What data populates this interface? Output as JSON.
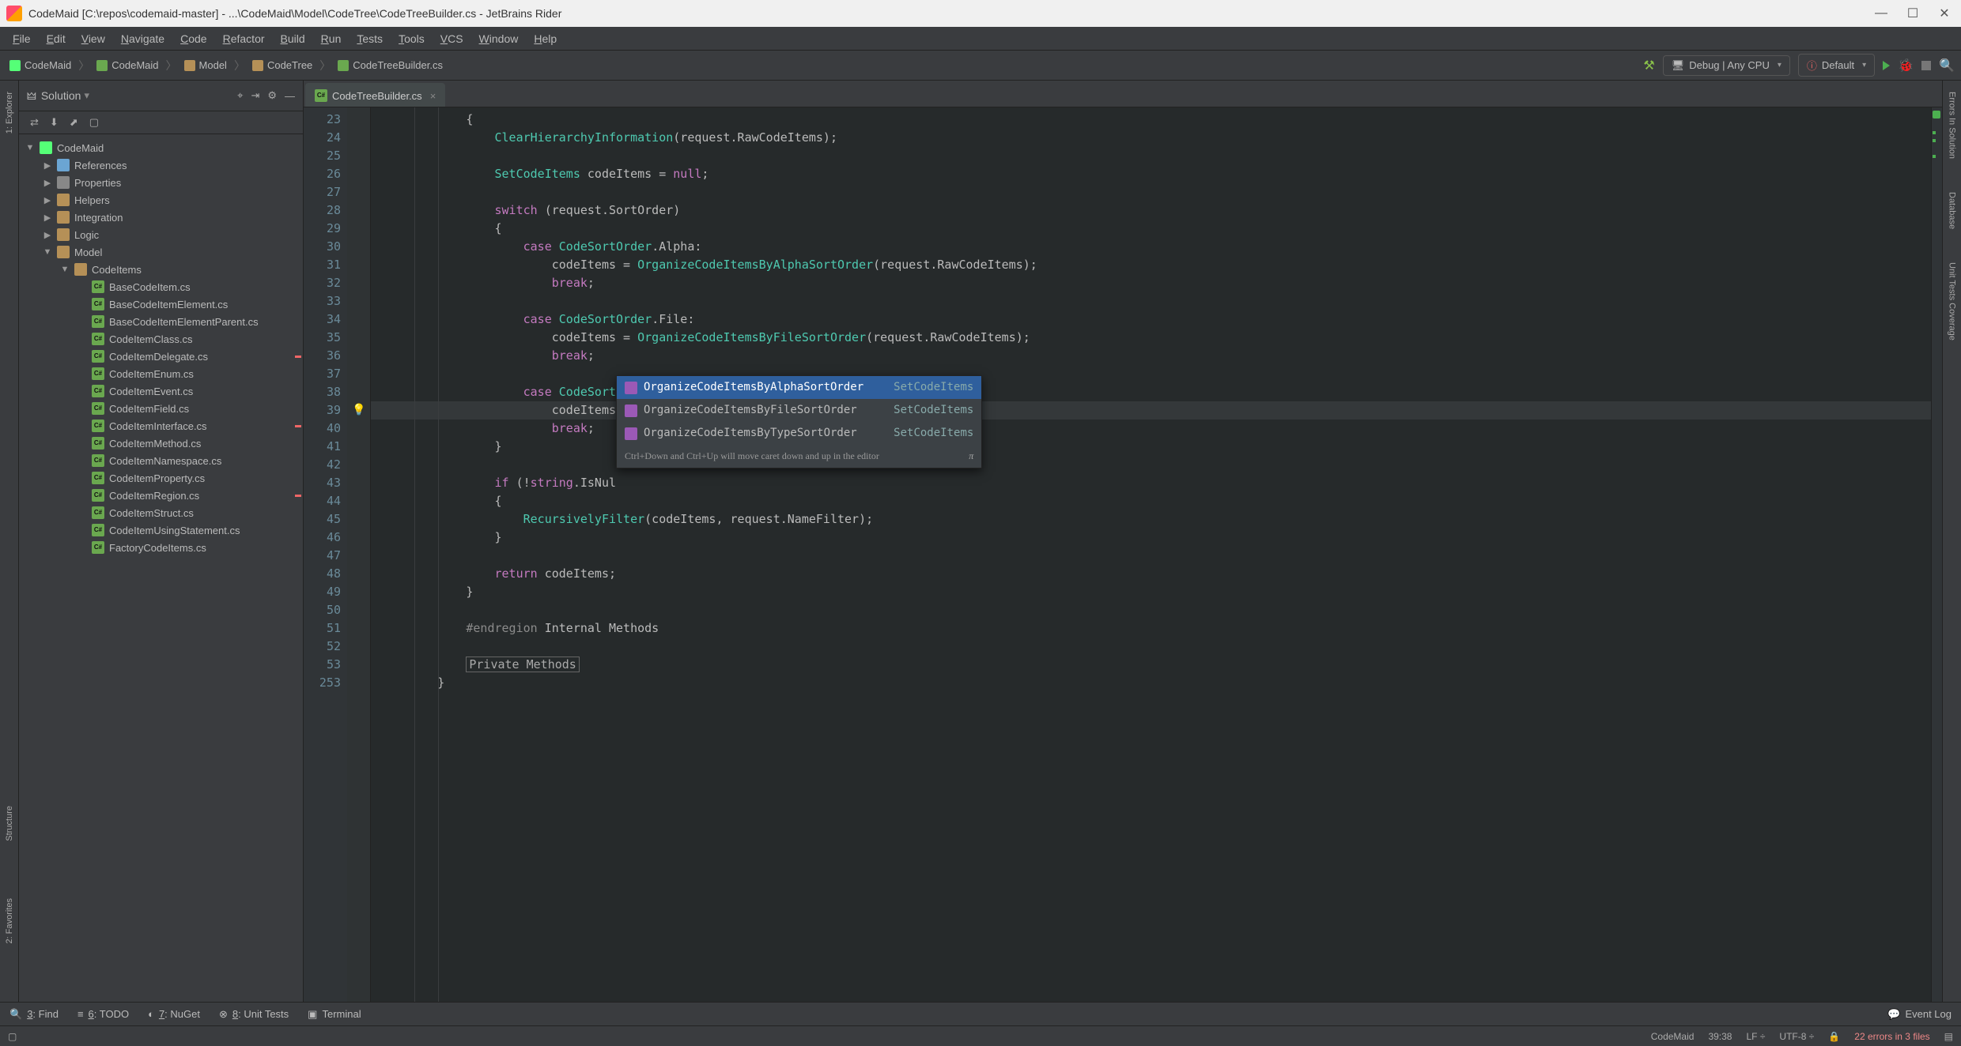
{
  "window_title": "CodeMaid [C:\\repos\\codemaid-master] - ...\\CodeMaid\\Model\\CodeTree\\CodeTreeBuilder.cs - JetBrains Rider",
  "menu": [
    "File",
    "Edit",
    "View",
    "Navigate",
    "Code",
    "Refactor",
    "Build",
    "Run",
    "Tests",
    "Tools",
    "VCS",
    "Window",
    "Help"
  ],
  "breadcrumb": [
    {
      "icon": "proj",
      "label": "CodeMaid"
    },
    {
      "icon": "cs",
      "label": "CodeMaid"
    },
    {
      "icon": "fold",
      "label": "Model"
    },
    {
      "icon": "fold",
      "label": "CodeTree"
    },
    {
      "icon": "cs",
      "label": "CodeTreeBuilder.cs"
    }
  ],
  "run_config": "Debug | Any CPU",
  "target_config": "Default",
  "solution_header": "Solution",
  "tree": {
    "root": {
      "label": "CodeMaid",
      "icon": "sol"
    },
    "nodes": [
      {
        "label": "References",
        "icon": "ref",
        "expand": false,
        "depth": 1
      },
      {
        "label": "Properties",
        "icon": "prop",
        "expand": false,
        "depth": 1
      },
      {
        "label": "Helpers",
        "icon": "foldr",
        "expand": false,
        "depth": 1
      },
      {
        "label": "Integration",
        "icon": "foldr",
        "expand": false,
        "depth": 1
      },
      {
        "label": "Logic",
        "icon": "foldr",
        "expand": false,
        "depth": 1
      },
      {
        "label": "Model",
        "icon": "foldr",
        "expand": true,
        "depth": 1
      },
      {
        "label": "CodeItems",
        "icon": "foldr",
        "expand": true,
        "depth": 2
      },
      {
        "label": "BaseCodeItem.cs",
        "icon": "csfile",
        "depth": 3
      },
      {
        "label": "BaseCodeItemElement.cs",
        "icon": "csfile",
        "depth": 3
      },
      {
        "label": "BaseCodeItemElementParent.cs",
        "icon": "csfile",
        "depth": 3
      },
      {
        "label": "CodeItemClass.cs",
        "icon": "csfile",
        "depth": 3
      },
      {
        "label": "CodeItemDelegate.cs",
        "icon": "csfile",
        "depth": 3,
        "err": true
      },
      {
        "label": "CodeItemEnum.cs",
        "icon": "csfile",
        "depth": 3
      },
      {
        "label": "CodeItemEvent.cs",
        "icon": "csfile",
        "depth": 3
      },
      {
        "label": "CodeItemField.cs",
        "icon": "csfile",
        "depth": 3
      },
      {
        "label": "CodeItemInterface.cs",
        "icon": "csfile",
        "depth": 3,
        "err": true
      },
      {
        "label": "CodeItemMethod.cs",
        "icon": "csfile",
        "depth": 3
      },
      {
        "label": "CodeItemNamespace.cs",
        "icon": "csfile",
        "depth": 3
      },
      {
        "label": "CodeItemProperty.cs",
        "icon": "csfile",
        "depth": 3
      },
      {
        "label": "CodeItemRegion.cs",
        "icon": "csfile",
        "depth": 3,
        "err": true
      },
      {
        "label": "CodeItemStruct.cs",
        "icon": "csfile",
        "depth": 3
      },
      {
        "label": "CodeItemUsingStatement.cs",
        "icon": "csfile",
        "depth": 3
      },
      {
        "label": "FactoryCodeItems.cs",
        "icon": "csfile",
        "depth": 3
      }
    ]
  },
  "tab_label": "CodeTreeBuilder.cs",
  "code": {
    "first_line": 23,
    "lines": [
      "            {",
      "                ClearHierarchyInformation(request.RawCodeItems);",
      "",
      "                SetCodeItems codeItems = null;",
      "",
      "                switch (request.SortOrder)",
      "                {",
      "                    case CodeSortOrder.Alpha:",
      "                        codeItems = OrganizeCodeItemsByAlphaSortOrder(request.RawCodeItems);",
      "                        break;",
      "",
      "                    case CodeSortOrder.File:",
      "                        codeItems = OrganizeCodeItemsByFileSortOrder(request.RawCodeItems);",
      "                        break;",
      "",
      "                    case CodeSortOrder.Type:",
      "                        codeItems = ocite",
      "                        break;",
      "                }",
      "",
      "                if (!string.IsNul",
      "                {",
      "                    RecursivelyFilter(codeItems, request.NameFilter);",
      "                }",
      "",
      "                return codeItems;",
      "            }",
      "",
      "            #endregion Internal Methods",
      "",
      "            Private Methods"
    ],
    "trailing_line_number": 253
  },
  "completion": {
    "items": [
      {
        "label": "OrganizeCodeItemsByAlphaSortOrder",
        "ret": "SetCodeItems",
        "selected": true
      },
      {
        "label": "OrganizeCodeItemsByFileSortOrder",
        "ret": "SetCodeItems"
      },
      {
        "label": "OrganizeCodeItemsByTypeSortOrder",
        "ret": "SetCodeItems"
      }
    ],
    "hint": "Ctrl+Down and Ctrl+Up will move caret down and up in the editor",
    "pi": "π"
  },
  "bottom_tools": [
    {
      "icon": "🔍",
      "key": "3",
      "label": "Find"
    },
    {
      "icon": "≡",
      "key": "6",
      "label": "TODO"
    },
    {
      "icon": "◐",
      "key": "7",
      "label": "NuGet"
    },
    {
      "icon": "⊗",
      "key": "8",
      "label": "Unit Tests"
    },
    {
      "icon": "▣",
      "key": "",
      "label": "Terminal"
    }
  ],
  "event_log": "Event Log",
  "status": {
    "project": "CodeMaid",
    "pos": "39:38",
    "le": "LF",
    "enc": "UTF-8",
    "errors": "22 errors in 3 files"
  },
  "left_tools": [
    "1: Explorer"
  ],
  "left_tools_bottom": [
    "Structure",
    "2: Favorites"
  ],
  "right_tools": [
    "Errors In Solution",
    "Database",
    "Unit Tests Coverage"
  ]
}
